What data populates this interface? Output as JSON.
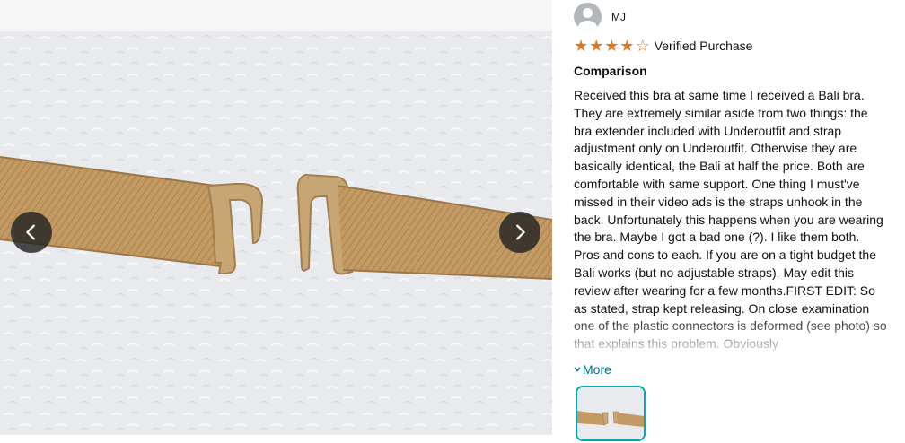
{
  "reviewer": {
    "name": "MJ",
    "avatar_icon": "user-avatar-icon"
  },
  "rating": {
    "value": 4,
    "max": 5,
    "filled_star": "★",
    "empty_star": "☆",
    "verified_label": "Verified Purchase"
  },
  "review": {
    "title": "Comparison",
    "body": "Received this bra at same time I received a Bali bra. They are extremely similar aside from two things: the bra extender included with Underoutfit and strap adjustment only on Underoutfit. Otherwise they are basically identical, the Bali at half the price. Both are comfortable with same support. One thing I must've missed in their video ads is the straps unhook in the back. Unfortunately this happens when you are wearing the bra. Maybe I got a bad one (?). I like them both. Pros and cons to each. If you are on a tight budget the Bali works (but no adjustable straps). May edit this review after wearing for a few months.FIRST EDIT: So as stated, strap kept releasing. On close examination one of the plastic connectors is deformed (see photo) so that explains this problem. Obviously",
    "more_label": "More",
    "more_icon": "chevron-down-icon"
  },
  "gallery": {
    "prev_icon": "chevron-left-icon",
    "next_icon": "chevron-right-icon"
  },
  "colors": {
    "star": "#de7921",
    "link": "#007185",
    "thumb_border": "#00a8b8",
    "strap": "#c39a63"
  }
}
